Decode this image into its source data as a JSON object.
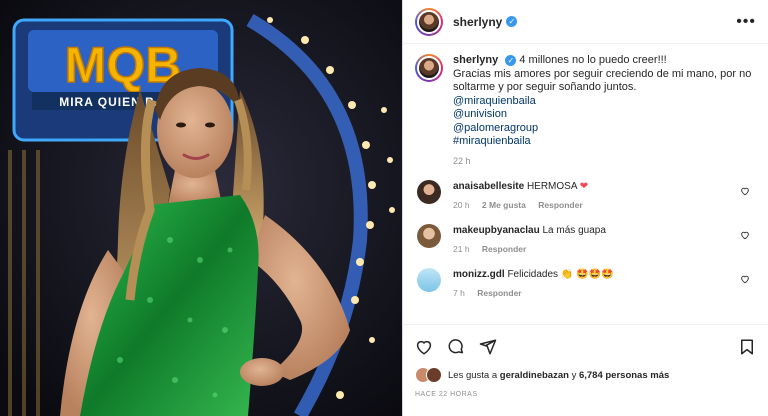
{
  "post": {
    "username": "sherlyny",
    "caption_user": "sherlyny",
    "caption_line1": "4 millones no lo puedo creer!!!",
    "caption_line2": "Gracias mis amores por seguir creciendo de mi mano, por no soltarme y por seguir soñando juntos.",
    "tags": [
      "@miraquienbaila",
      "@univision",
      "@palomeragroup",
      "#miraquienbaila"
    ],
    "time": "22 h"
  },
  "photo": {
    "logo_text": "MQB",
    "logo_sub": "MIRA QUIEN BAILA"
  },
  "comments": [
    {
      "user": "anaisabellesite",
      "text": "HERMOSA",
      "emoji": "❤",
      "time": "20 h",
      "likes": "2 Me gusta",
      "reply": "Responder",
      "avatar_color": "#3b2a22"
    },
    {
      "user": "makeupbyanaclau",
      "text": "La más guapa",
      "emoji": "",
      "time": "21 h",
      "likes": "",
      "reply": "Responder",
      "avatar_color": "#a07a5a"
    },
    {
      "user": "monizz.gdl",
      "text": "Felicidades",
      "emoji": "👏 🤩🤩🤩",
      "time": "7 h",
      "likes": "",
      "reply": "Responder",
      "avatar_color": "#8fd0ec"
    }
  ],
  "likes": {
    "prefix": "Les gusta a",
    "user": "geraldinebazan",
    "and": "y",
    "count": "6,784 personas más"
  },
  "ago": "HACE 22 HORAS",
  "colors": {
    "link": "#00376b",
    "verified": "#3897f0",
    "heart": "#ed4956",
    "dress": "#1f9b3a"
  }
}
